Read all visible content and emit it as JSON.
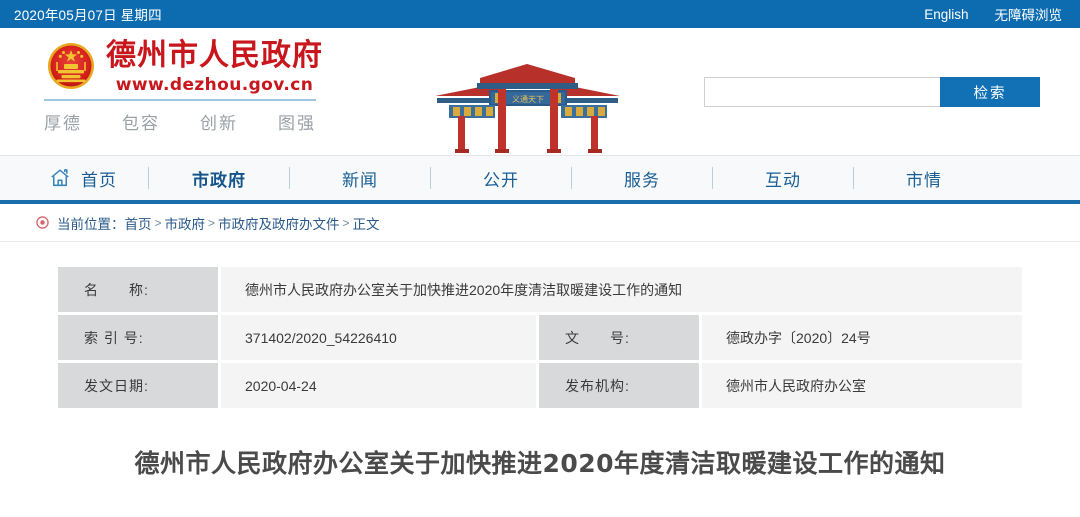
{
  "topbar": {
    "date": "2020年05月07日 星期四",
    "links": [
      {
        "label": "English",
        "name": "english"
      },
      {
        "label": "无障碍浏览",
        "name": "accessibility"
      }
    ]
  },
  "header": {
    "emblem_icon": "china-national-emblem-icon",
    "site_title": "德州市人民政府",
    "site_url": "www.dezhou.gov.cn",
    "slogan": [
      "厚德",
      "包容",
      "创新",
      "图强"
    ],
    "archway_icon": "chinese-paifang-archway-image",
    "search": {
      "value": "",
      "placeholder": "",
      "button_label": "检索",
      "icon": "search-icon"
    }
  },
  "nav": {
    "home_icon": "home-icon",
    "items": [
      {
        "label": "首页",
        "active": false
      },
      {
        "label": "市政府",
        "active": true
      },
      {
        "label": "新闻",
        "active": false
      },
      {
        "label": "公开",
        "active": false
      },
      {
        "label": "服务",
        "active": false
      },
      {
        "label": "互动",
        "active": false
      },
      {
        "label": "市情",
        "active": false
      }
    ]
  },
  "breadcrumb": {
    "pin_icon": "location-pin-icon",
    "label": "当前位置：",
    "items": [
      "首页",
      "市政府",
      "市政府及政府办文件",
      "正文"
    ],
    "separator": ">"
  },
  "doc_info": {
    "rows": [
      {
        "cells": [
          {
            "label": "名　　称:",
            "value": "德州市人民政府办公室关于加快推进2020年度清洁取暖建设工作的通知",
            "span": true
          }
        ]
      },
      {
        "cells": [
          {
            "label": "索 引 号:",
            "value": "371402/2020_54226410"
          },
          {
            "label": "文　　号:",
            "value": "德政办字〔2020〕24号"
          }
        ]
      },
      {
        "cells": [
          {
            "label": "发文日期:",
            "value": "2020-04-24"
          },
          {
            "label": "发布机构:",
            "value": "德州市人民政府办公室"
          }
        ]
      }
    ]
  },
  "article": {
    "title": "德州市人民政府办公室关于加快推进2020年度清洁取暖建设工作的通知"
  },
  "colors": {
    "topbar_blue": "#0d6cb0",
    "nav_blue": "#1a6eab",
    "brand_red": "#c8161d",
    "label_gray": "#d8d9da",
    "value_gray": "#f4f4f4"
  }
}
